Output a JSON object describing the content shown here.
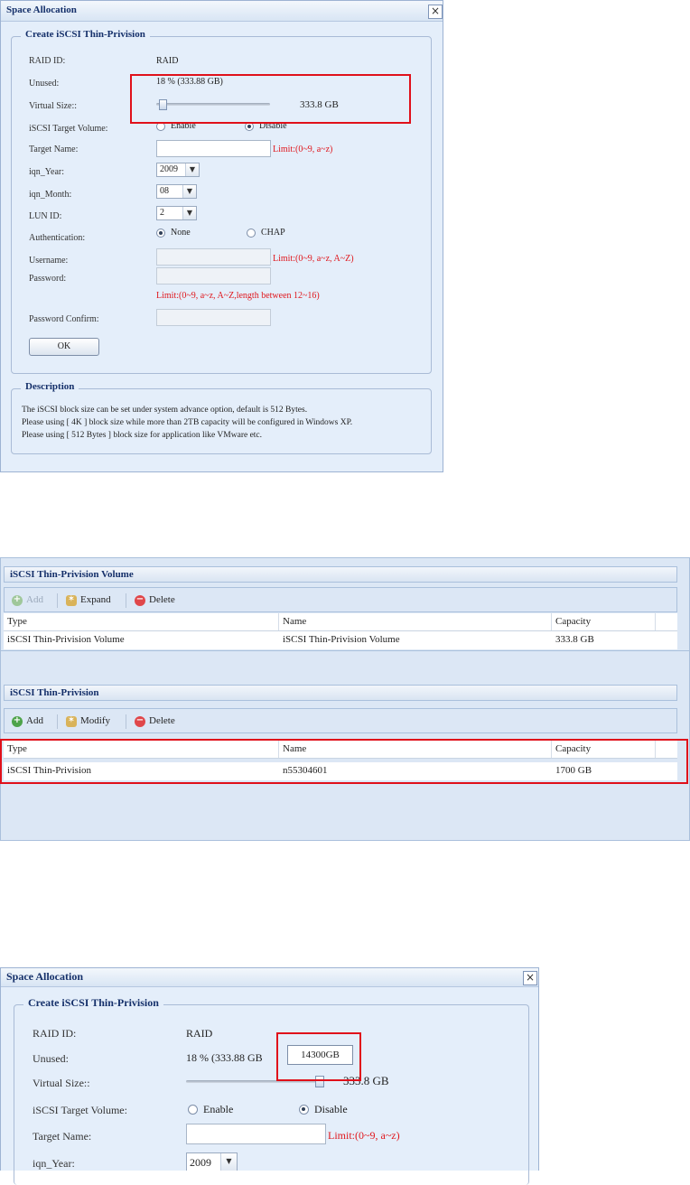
{
  "dialog1": {
    "title": "Space Allocation",
    "close": "×",
    "form_legend": "Create iSCSI Thin-Privision",
    "raid_id_label": "RAID ID:",
    "raid_id_value": "RAID",
    "unused_label": "Unused:",
    "unused_value": "18 % (333.88 GB)",
    "virtual_size_label": "Virtual Size::",
    "virtual_size_value": "333.8 GB",
    "target_volume_label": "iSCSI Target Volume:",
    "enable_label": "Enable",
    "disable_label": "Disable",
    "target_name_label": "Target Name:",
    "target_name_hint": "Limit:(0~9, a~z)",
    "iqn_year_label": "iqn_Year:",
    "iqn_year_value": "2009",
    "iqn_month_label": "iqn_Month:",
    "iqn_month_value": "08",
    "lun_id_label": "LUN ID:",
    "lun_id_value": "2",
    "auth_label": "Authentication:",
    "auth_none": "None",
    "auth_chap": "CHAP",
    "username_label": "Username:",
    "username_hint": "Limit:(0~9, a~z, A~Z)",
    "password_label": "Password:",
    "password_hint": "Limit:(0~9, a~z, A~Z,length between 12~16)",
    "password_confirm_label": "Password Confirm:",
    "ok_label": "OK",
    "desc_legend": "Description",
    "desc_lines": [
      "The iSCSI block size can be set under system advance option, default is 512 Bytes.",
      "Please using [ 4K ] block size while more than 2TB capacity will be configured in Windows XP.",
      "Please using [ 512 Bytes ] block size for application like VMware etc."
    ]
  },
  "panel": {
    "volume_section_title": "iSCSI Thin-Privision Volume",
    "volume_toolbar": {
      "add": "Add",
      "expand": "Expand",
      "delete": "Delete"
    },
    "volume_table": {
      "headers": [
        "Type",
        "Name",
        "Capacity"
      ],
      "rows": [
        [
          "iSCSI Thin-Privision Volume",
          "iSCSI Thin-Privision Volume",
          "333.8 GB"
        ]
      ]
    },
    "thin_section_title": "iSCSI Thin-Privision",
    "thin_toolbar": {
      "add": "Add",
      "modify": "Modify",
      "delete": "Delete"
    },
    "thin_table": {
      "headers": [
        "Type",
        "Name",
        "Capacity"
      ],
      "rows": [
        [
          "iSCSI Thin-Privision",
          "n55304601",
          "1700 GB"
        ]
      ]
    }
  },
  "dialog2": {
    "title": "Space Allocation",
    "close": "×",
    "form_legend": "Create iSCSI Thin-Privision",
    "raid_id_label": "RAID ID:",
    "raid_id_value": "RAID",
    "unused_label": "Unused:",
    "unused_value": "18 % (333.88 GB",
    "tooltip": "14300GB",
    "virtual_size_label": "Virtual Size::",
    "virtual_size_value": "333.8 GB",
    "target_volume_label": "iSCSI Target Volume:",
    "enable_label": "Enable",
    "disable_label": "Disable",
    "target_name_label": "Target Name:",
    "target_name_hint": "Limit:(0~9, a~z)",
    "iqn_year_label": "iqn_Year:",
    "iqn_year_value": "2009"
  }
}
